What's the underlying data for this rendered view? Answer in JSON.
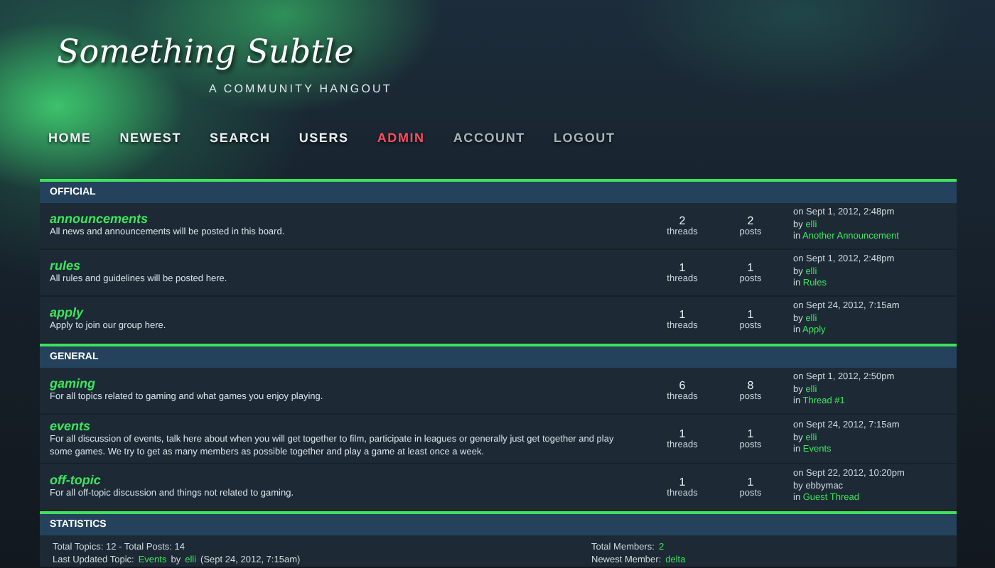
{
  "site": {
    "title": "Something Subtle",
    "tagline": "A COMMUNITY HANGOUT"
  },
  "nav": [
    {
      "label": "HOME",
      "color": "#e8eef2"
    },
    {
      "label": "NEWEST",
      "color": "#e8eef2"
    },
    {
      "label": "SEARCH",
      "color": "#e8eef2"
    },
    {
      "label": "USERS",
      "color": "#e8eef2"
    },
    {
      "label": "ADMIN",
      "color": "#ff4d5e"
    },
    {
      "label": "ACCOUNT",
      "color": "#a9b2b8"
    },
    {
      "label": "LOGOUT",
      "color": "#a9b2b8"
    }
  ],
  "sections": [
    {
      "title": "OFFICIAL",
      "boards": [
        {
          "name": "announcements",
          "description": "All news and announcements will be posted in this board.",
          "threads": "2",
          "threads_label": "threads",
          "posts": "2",
          "posts_label": "posts",
          "last_post": {
            "date": "on Sept 1, 2012, 2:48pm",
            "author_prefix": "by",
            "author": "elli",
            "author_highlighted": true,
            "topic_prefix": "in",
            "topic": "Another Announcement"
          }
        },
        {
          "name": "rules",
          "description": "All rules and guidelines will be posted here.",
          "threads": "1",
          "threads_label": "threads",
          "posts": "1",
          "posts_label": "posts",
          "last_post": {
            "date": "on Sept 1, 2012, 2:48pm",
            "author_prefix": "by",
            "author": "elli",
            "author_highlighted": true,
            "topic_prefix": "in",
            "topic": "Rules"
          }
        },
        {
          "name": "apply",
          "description": "Apply to join our group here.",
          "threads": "1",
          "threads_label": "threads",
          "posts": "1",
          "posts_label": "posts",
          "last_post": {
            "date": "on Sept 24, 2012, 7:15am",
            "author_prefix": "by",
            "author": "elli",
            "author_highlighted": true,
            "topic_prefix": "in",
            "topic": "Apply"
          }
        }
      ]
    },
    {
      "title": "GENERAL",
      "boards": [
        {
          "name": "gaming",
          "description": "For all topics related to gaming and what games you enjoy playing.",
          "threads": "6",
          "threads_label": "threads",
          "posts": "8",
          "posts_label": "posts",
          "last_post": {
            "date": "on Sept 1, 2012, 2:50pm",
            "author_prefix": "by",
            "author": "elli",
            "author_highlighted": true,
            "topic_prefix": "in",
            "topic": "Thread #1"
          }
        },
        {
          "name": "events",
          "description": "For all discussion of events, talk here about when you will get together to film, participate in leagues or generally just get together and play some games. We try to get as many members as possible together and play a game at least once a week.",
          "threads": "1",
          "threads_label": "threads",
          "posts": "1",
          "posts_label": "posts",
          "last_post": {
            "date": "on Sept 24, 2012, 7:15am",
            "author_prefix": "by",
            "author": "elli",
            "author_highlighted": true,
            "topic_prefix": "in",
            "topic": "Events"
          }
        },
        {
          "name": "off-topic",
          "description": "For all off-topic discussion and things not related to gaming.",
          "threads": "1",
          "threads_label": "threads",
          "posts": "1",
          "posts_label": "posts",
          "last_post": {
            "date": "on Sept 22, 2012, 10:20pm",
            "author_prefix": "by",
            "author": "ebbymac",
            "author_highlighted": false,
            "topic_prefix": "in",
            "topic": "Guest Thread"
          }
        }
      ]
    }
  ],
  "statistics": {
    "title": "STATISTICS",
    "left": [
      [
        {
          "text": "Total Topics: 12  -  Total Posts: 14",
          "link": false
        }
      ],
      [
        {
          "text": "Last Updated Topic:",
          "link": false
        },
        {
          "text": "Events",
          "link": true
        },
        {
          "text": "by",
          "link": false
        },
        {
          "text": "elli",
          "link": true
        },
        {
          "text": "(Sept 24, 2012, 7:15am)",
          "link": false
        }
      ]
    ],
    "right": [
      [
        {
          "text": "Total Members:",
          "link": false
        },
        {
          "text": "2",
          "link": true
        }
      ],
      [
        {
          "text": "Newest Member:",
          "link": false
        },
        {
          "text": "delta",
          "link": true
        }
      ]
    ]
  }
}
